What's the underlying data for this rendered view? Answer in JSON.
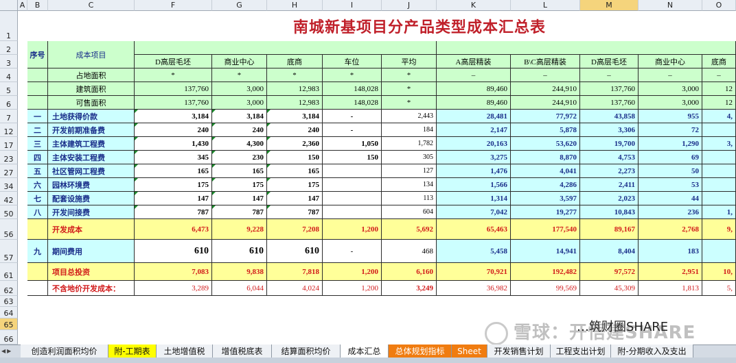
{
  "app": {
    "selected_column": "M"
  },
  "title": "南城新基项目分产品类型成本汇总表",
  "columns": [
    "A",
    "B",
    "C",
    "F",
    "G",
    "H",
    "I",
    "J",
    "K",
    "L",
    "M",
    "N",
    "O"
  ],
  "rows_visible": [
    "1",
    "2",
    "3",
    "4",
    "5",
    "6",
    "7",
    "12",
    "17",
    "23",
    "27",
    "34",
    "42",
    "50",
    "56",
    "57",
    "61",
    "62",
    "63",
    "64",
    "65",
    "66"
  ],
  "header": {
    "seq": "序号",
    "item": "成本项目",
    "group1": [
      "D高层毛坯",
      "商业中心",
      "底商",
      "车位",
      "平均"
    ],
    "group2": [
      "A高层精装",
      "B\\C高层精装",
      "D高层毛坯",
      "商业中心",
      "底商"
    ]
  },
  "area_rows": [
    {
      "label": "占地面积",
      "vals1": [
        "*",
        "*",
        "*",
        "*",
        "*"
      ],
      "vals2": [
        "–",
        "–",
        "–",
        "–",
        "–"
      ]
    },
    {
      "label": "建筑面积",
      "vals1": [
        "137,760",
        "3,000",
        "12,983",
        "148,028",
        "*"
      ],
      "vals2": [
        "89,460",
        "244,910",
        "137,760",
        "3,000",
        "12"
      ]
    },
    {
      "label": "可售面积",
      "vals1": [
        "137,760",
        "3,000",
        "12,983",
        "148,028",
        "*"
      ],
      "vals2": [
        "89,460",
        "244,910",
        "137,760",
        "3,000",
        "12"
      ]
    }
  ],
  "cost_rows": [
    {
      "no": "一",
      "label": "土地获得价款",
      "vals1": [
        "3,184",
        "3,184",
        "3,184",
        "-",
        "2,443"
      ],
      "vals2": [
        "28,481",
        "77,972",
        "43,858",
        "955",
        "4,"
      ]
    },
    {
      "no": "二",
      "label": "开发前期准备费",
      "vals1": [
        "240",
        "240",
        "240",
        "-",
        "184"
      ],
      "vals2": [
        "2,147",
        "5,878",
        "3,306",
        "72",
        ""
      ]
    },
    {
      "no": "三",
      "label": "主体建筑工程费",
      "vals1": [
        "1,430",
        "4,300",
        "2,360",
        "1,050",
        "1,782"
      ],
      "vals2": [
        "20,163",
        "53,620",
        "19,700",
        "1,290",
        "3,"
      ]
    },
    {
      "no": "四",
      "label": "主体安装工程费",
      "vals1": [
        "345",
        "230",
        "150",
        "150",
        "305"
      ],
      "vals2": [
        "3,275",
        "8,870",
        "4,753",
        "69",
        ""
      ]
    },
    {
      "no": "五",
      "label": "社区管网工程费",
      "vals1": [
        "165",
        "165",
        "165",
        "",
        "127"
      ],
      "vals2": [
        "1,476",
        "4,041",
        "2,273",
        "50",
        ""
      ]
    },
    {
      "no": "六",
      "label": "园林环境费",
      "vals1": [
        "175",
        "175",
        "175",
        "",
        "134"
      ],
      "vals2": [
        "1,566",
        "4,286",
        "2,411",
        "53",
        ""
      ]
    },
    {
      "no": "七",
      "label": "配套设施费",
      "vals1": [
        "147",
        "147",
        "147",
        "",
        "113"
      ],
      "vals2": [
        "1,314",
        "3,597",
        "2,023",
        "44",
        ""
      ]
    },
    {
      "no": "八",
      "label": "开发间接费",
      "vals1": [
        "787",
        "787",
        "787",
        "",
        "604"
      ],
      "vals2": [
        "7,042",
        "19,277",
        "10,843",
        "236",
        "1,"
      ]
    }
  ],
  "dev_cost": {
    "label": "开发成本",
    "vals1": [
      "6,473",
      "9,228",
      "7,208",
      "1,200",
      "5,692"
    ],
    "vals2": [
      "65,463",
      "177,540",
      "89,167",
      "2,768",
      "9,"
    ]
  },
  "period_cost": {
    "no": "九",
    "label": "期间费用",
    "vals1": [
      "610",
      "610",
      "610",
      "-",
      "468"
    ],
    "vals2": [
      "5,458",
      "14,941",
      "8,404",
      "183",
      ""
    ]
  },
  "total": {
    "label": "项目总投资",
    "vals1": [
      "7,083",
      "9,838",
      "7,818",
      "1,200",
      "6,160"
    ],
    "vals2": [
      "70,921",
      "192,482",
      "97,572",
      "2,951",
      "10,"
    ]
  },
  "excl_land": {
    "label": "不含地价开发成本：",
    "vals1": [
      "3,289",
      "6,044",
      "4,024",
      "1,200",
      "3,249"
    ],
    "vals2": [
      "36,982",
      "99,569",
      "45,309",
      "1,813",
      "5,"
    ]
  },
  "tabs": [
    "创造利润面积均价",
    "附-工期表",
    "土地增值税",
    "增值税底表",
    "结算面积均价",
    "成本汇总",
    "总体规划指标",
    "Sheet",
    "开发销售计划",
    "工程支出计划",
    "附-分期收入及支出"
  ],
  "active_tab": "成本汇总",
  "watermark": "雪球：开悟建SHARE",
  "wechat_label": "…筑财圈SHARE"
}
